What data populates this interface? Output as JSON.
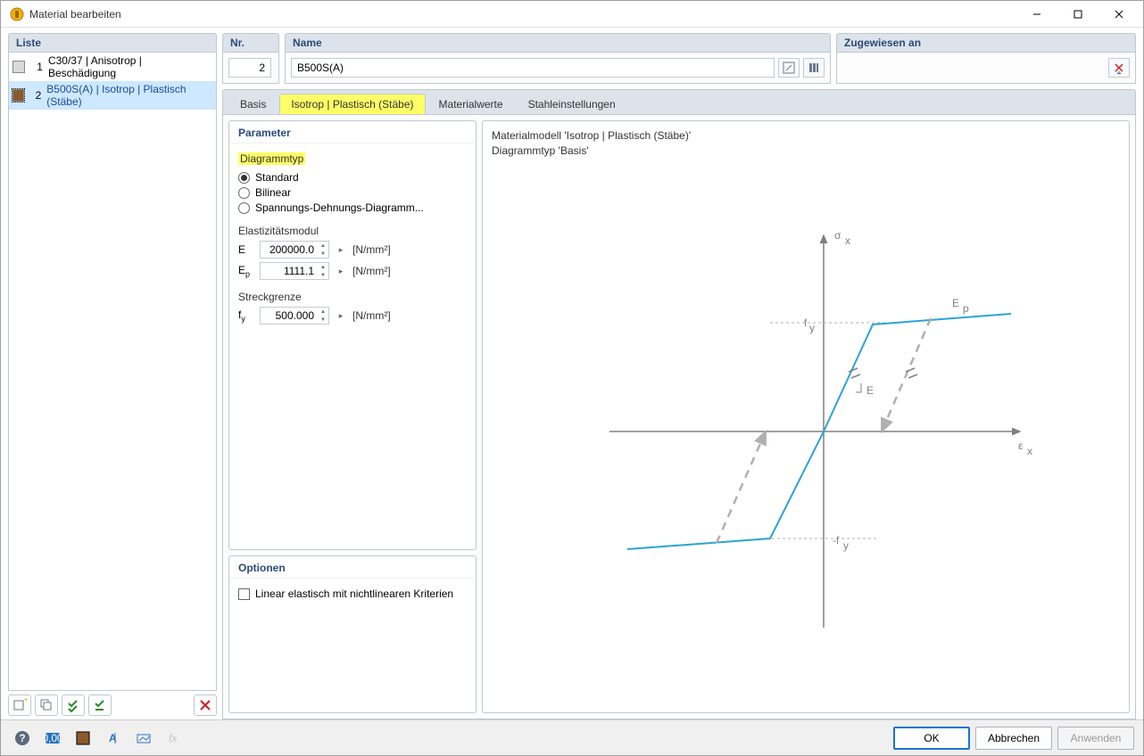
{
  "window": {
    "title": "Material bearbeiten"
  },
  "panels": {
    "list_header": "Liste",
    "nr_header": "Nr.",
    "name_header": "Name",
    "assigned_header": "Zugewiesen an"
  },
  "list_items": [
    {
      "num": "1",
      "label": "C30/37 | Anisotrop | Beschädigung",
      "color": "#d9d9d9",
      "selected": false
    },
    {
      "num": "2",
      "label": "B500S(A) | Isotrop | Plastisch (Stäbe)",
      "color": "#8a5a2b",
      "selected": true
    }
  ],
  "fields": {
    "nr_value": "2",
    "name_value": "B500S(A)"
  },
  "tabs": [
    {
      "id": "basis",
      "label": "Basis",
      "active": false
    },
    {
      "id": "iso-plast",
      "label": "Isotrop | Plastisch (Stäbe)",
      "active": true
    },
    {
      "id": "matwerte",
      "label": "Materialwerte",
      "active": false
    },
    {
      "id": "stahl",
      "label": "Stahleinstellungen",
      "active": false
    }
  ],
  "parameter": {
    "group_title": "Parameter",
    "diagrammtyp_label": "Diagrammtyp",
    "radios": [
      {
        "label": "Standard",
        "checked": true
      },
      {
        "label": "Bilinear",
        "checked": false
      },
      {
        "label": "Spannungs-Dehnungs-Diagramm...",
        "checked": false
      }
    ],
    "emodul_label": "Elastizitätsmodul",
    "E_sym": "E",
    "E_value": "200000.0",
    "E_unit": "[N/mm²]",
    "Ep_sym_html": "E<sub>p</sub>",
    "Ep_value": "1111.1",
    "Ep_unit": "[N/mm²]",
    "yield_label": "Streckgrenze",
    "fy_sym_html": "f<sub>y</sub>",
    "fy_value": "500.000",
    "fy_unit": "[N/mm²]"
  },
  "options": {
    "group_title": "Optionen",
    "checkbox_label": "Linear elastisch mit nichtlinearen Kriterien",
    "checked": false
  },
  "diagram": {
    "line1": "Materialmodell 'Isotrop | Plastisch (Stäbe)'",
    "line2": "Diagrammtyp 'Basis'",
    "sigma_label": "σ",
    "sigma_sub": "x",
    "eps_label": "ε",
    "eps_sub": "x",
    "Ep_label": "E",
    "Ep_sub": "p",
    "E_label": "E",
    "fy_label": "f",
    "fy_sub": "y",
    "neg_fy_label": "-f",
    "neg_fy_sub": "y"
  },
  "footer_buttons": {
    "ok": "OK",
    "cancel": "Abbrechen",
    "apply": "Anwenden"
  },
  "chart_data": {
    "type": "line",
    "description": "Bilinear elastic-plastic stress-strain curve (σ vs ε) with hardening modulus Ep and unloading path parallel to elastic slope E.",
    "xlabel": "ε_x",
    "ylabel": "σ_x",
    "ylim": [
      -550,
      550
    ],
    "annotations": [
      "f_y",
      "-f_y",
      "E",
      "E_p"
    ],
    "series": [
      {
        "name": "stress-strain",
        "x": [
          -0.1,
          -0.0025,
          0.0025,
          0.1
        ],
        "y": [
          -540,
          -500,
          500,
          540
        ]
      },
      {
        "name": "unloading",
        "x": [
          0.07,
          0.0675
        ],
        "y": [
          520,
          0
        ],
        "style": "dashed"
      }
    ]
  }
}
